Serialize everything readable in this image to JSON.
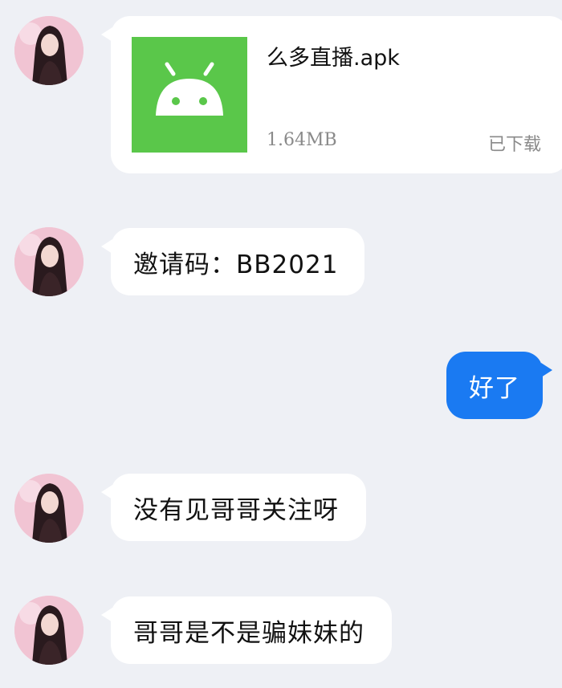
{
  "file_message": {
    "file_name": "么多直播.apk",
    "file_size": "1.64MB",
    "status": "已下载",
    "icon": "android-icon"
  },
  "messages": [
    {
      "side": "left",
      "text": "邀请码：BB2021"
    },
    {
      "side": "right",
      "text": "好了"
    },
    {
      "side": "left",
      "text": "没有见哥哥关注呀"
    },
    {
      "side": "left",
      "text": "哥哥是不是骗妹妹的"
    }
  ],
  "colors": {
    "background": "#eef0f5",
    "incoming_bubble": "#ffffff",
    "outgoing_bubble": "#1a7af2",
    "apk_icon": "#5ac74a"
  }
}
